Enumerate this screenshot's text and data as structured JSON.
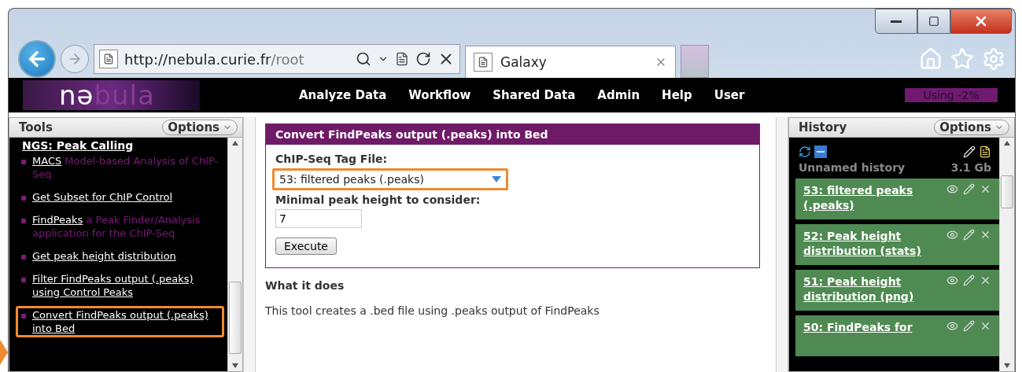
{
  "browser": {
    "url_host": "http://nebula.curie.fr",
    "url_path": "/root",
    "tab_title": "Galaxy"
  },
  "masthead": {
    "logo": {
      "lead": "nə",
      "tail": "bula"
    },
    "nav": [
      "Analyze Data",
      "Workflow",
      "Shared Data",
      "Admin",
      "Help",
      "User"
    ],
    "usage": "Using -2%"
  },
  "tools": {
    "title": "Tools",
    "options": "Options",
    "section": "NGS: Peak Calling",
    "items": [
      {
        "name": "MACS",
        "description": "Model-based Analysis of ChIP-Seq",
        "highlighted": false
      },
      {
        "name": "Get Subset for ChIP Control",
        "highlighted": false
      },
      {
        "name": "FindPeaks",
        "description": "a Peak Finder/Analysis application for the ChIP-Seq",
        "highlighted": false
      },
      {
        "name": "Get peak height distribution",
        "highlighted": false
      },
      {
        "name": "Filter FindPeaks output (.peaks) using Control Peaks",
        "highlighted": false
      },
      {
        "name": "Convert FindPeaks output (.peaks) into Bed",
        "highlighted": true
      }
    ]
  },
  "tool_form": {
    "title": "Convert FindPeaks output (.peaks) into Bed",
    "fields": [
      {
        "kind": "select",
        "label": "ChIP-Seq Tag File:",
        "value": "53: filtered peaks (.peaks)",
        "highlighted": true
      },
      {
        "kind": "text",
        "label": "Minimal peak height to consider:",
        "value": "7",
        "highlighted": false
      }
    ],
    "execute": "Execute",
    "help_title": "What it does",
    "help_text": "This tool creates a .bed file using .peaks output of FindPeaks"
  },
  "history": {
    "title": "History",
    "options": "Options",
    "name": "Unnamed history",
    "size": "3.1 Gb",
    "items": [
      {
        "title": "53: filtered peaks (.peaks)"
      },
      {
        "title": "52: Peak height distribution (stats)"
      },
      {
        "title": "51: Peak height distribution (png)"
      },
      {
        "title": "50: FindPeaks for"
      }
    ]
  }
}
